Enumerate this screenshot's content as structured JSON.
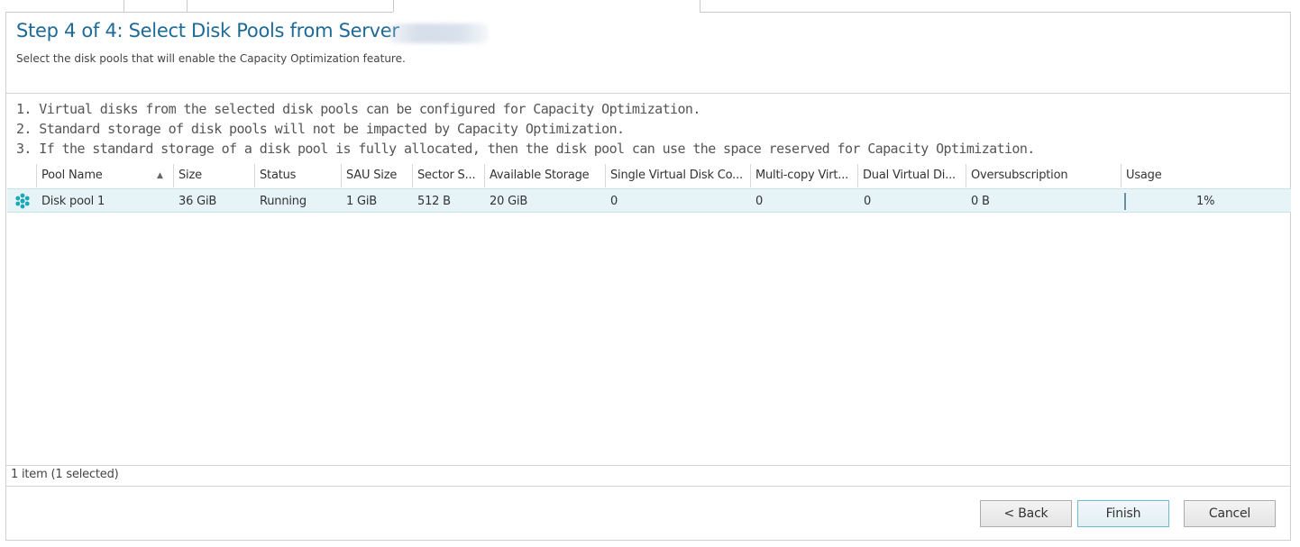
{
  "wizard": {
    "title": "Step 4 of 4: Select Disk Pools from Server",
    "subtitle": "Select the disk pools that will enable the Capacity Optimization feature.",
    "notes": [
      "1. Virtual disks from the selected disk pools can be configured for Capacity Optimization.",
      "2. Standard storage of disk pools will not be impacted by Capacity Optimization.",
      "3. If the standard storage of a disk pool is fully allocated, then the disk pool can use the space reserved for Capacity Optimization."
    ]
  },
  "grid": {
    "columns": [
      "Pool Name",
      "Size",
      "Status",
      "SAU Size",
      "Sector S...",
      "Available Storage",
      "Single Virtual Disk Co...",
      "Multi-copy Virt...",
      "Dual Virtual Di...",
      "Oversubscription",
      "Usage"
    ],
    "sorted_column": "Pool Name",
    "sort_direction": "ascending",
    "rows": [
      {
        "icon": "disk-pool-icon",
        "selected": true,
        "cells": [
          "Disk pool 1",
          "36 GiB",
          "Running",
          "1 GiB",
          "512 B",
          "20 GiB",
          "0",
          "0",
          "0",
          "0 B",
          "1%"
        ],
        "usage_fraction": 0.01
      }
    ],
    "status_text": "1 item (1 selected)"
  },
  "buttons": {
    "back": "< Back",
    "finish": "Finish",
    "cancel": "Cancel"
  },
  "colors": {
    "title": "#1e6a96",
    "row_selected": "#e6f3f7",
    "icon": "#1aa7b8"
  }
}
